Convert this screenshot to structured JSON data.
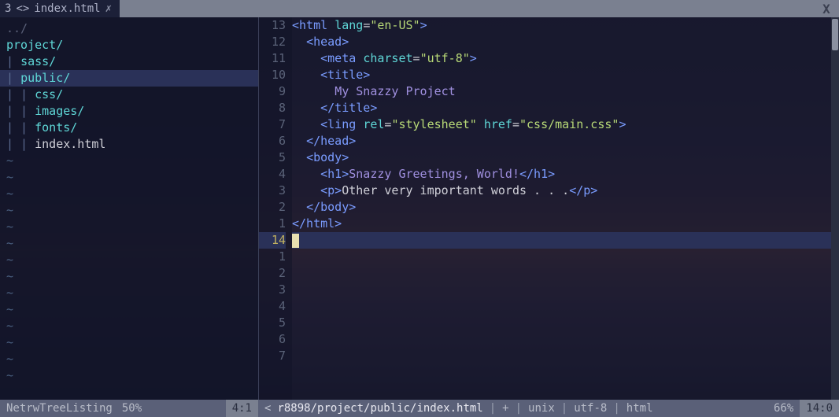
{
  "tabbar": {
    "index": "3",
    "icon": "<>",
    "filename": "index.html",
    "modified": "✗",
    "close": "X"
  },
  "tree": {
    "lines": [
      {
        "pipes": "",
        "name": "../",
        "cls": "c-dim",
        "sel": false
      },
      {
        "pipes": "",
        "name": "project/",
        "cls": "c-dir",
        "sel": false
      },
      {
        "pipes": "| ",
        "name": "sass/",
        "cls": "c-dir",
        "sel": false
      },
      {
        "pipes": "| ",
        "name": "public/",
        "cls": "c-dir",
        "sel": true
      },
      {
        "pipes": "| | ",
        "name": "css/",
        "cls": "c-dir",
        "sel": false
      },
      {
        "pipes": "| | ",
        "name": "images/",
        "cls": "c-dir",
        "sel": false
      },
      {
        "pipes": "| | ",
        "name": "fonts/",
        "cls": "c-dir",
        "sel": false
      },
      {
        "pipes": "| | ",
        "name": "index.html",
        "cls": "c-file",
        "sel": false
      }
    ]
  },
  "editor": {
    "gutter": [
      "13",
      "12",
      "11",
      "10",
      "9",
      "8",
      "7",
      "6",
      "5",
      "4",
      "3",
      "2",
      "1",
      "14",
      "1",
      "2",
      "3",
      "4",
      "5",
      "6",
      "7"
    ],
    "cursor_line_index": 13
  },
  "code": {
    "l0": {
      "i": "",
      "open": "<html",
      "sp": " ",
      "attr": "lang",
      "eq": "=",
      "str": "\"en-US\"",
      "close": ">"
    },
    "l1": {
      "i": "  ",
      "open": "<head>",
      "rest": ""
    },
    "l2": {
      "i": "    ",
      "open": "<meta",
      "sp": " ",
      "attr": "charset",
      "eq": "=",
      "str": "\"utf-8\"",
      "close": ">"
    },
    "l3": {
      "i": "    ",
      "open": "<title>",
      "rest": ""
    },
    "l4": {
      "i": "      ",
      "txt": "My Snazzy Project"
    },
    "l5": {
      "i": "    ",
      "close": "</title>"
    },
    "l6": {
      "i": "    ",
      "open": "<ling",
      "sp": " ",
      "attr1": "rel",
      "eq1": "=",
      "str1": "\"stylesheet\"",
      "sp2": " ",
      "attr2": "href",
      "eq2": "=",
      "str2": "\"css/main.css\"",
      "close": ">"
    },
    "l7": {
      "i": "  ",
      "close": "</head>"
    },
    "l8": {
      "i": "  ",
      "open": "<body>",
      "rest": ""
    },
    "l9": {
      "i": "    ",
      "open": "<h1>",
      "txt": "Snazzy Greetings, World!",
      "close": "</h1>"
    },
    "l10": {
      "i": "    ",
      "open": "<p>",
      "txt": "Other very important words . . .",
      "close": "</p>"
    },
    "l11": {
      "i": "  ",
      "close": "</body>"
    },
    "l12": {
      "i": "",
      "close": "</html>"
    }
  },
  "status": {
    "left": {
      "name": "NetrwTreeListing",
      "pct": "50%",
      "pos": "4:1"
    },
    "right": {
      "arrow": "<",
      "path": "r8898/project/public/index.html",
      "mod": "+",
      "fmt": "unix",
      "enc": "utf-8",
      "ft": "html",
      "pct": "66%",
      "pos": "14:0"
    }
  }
}
